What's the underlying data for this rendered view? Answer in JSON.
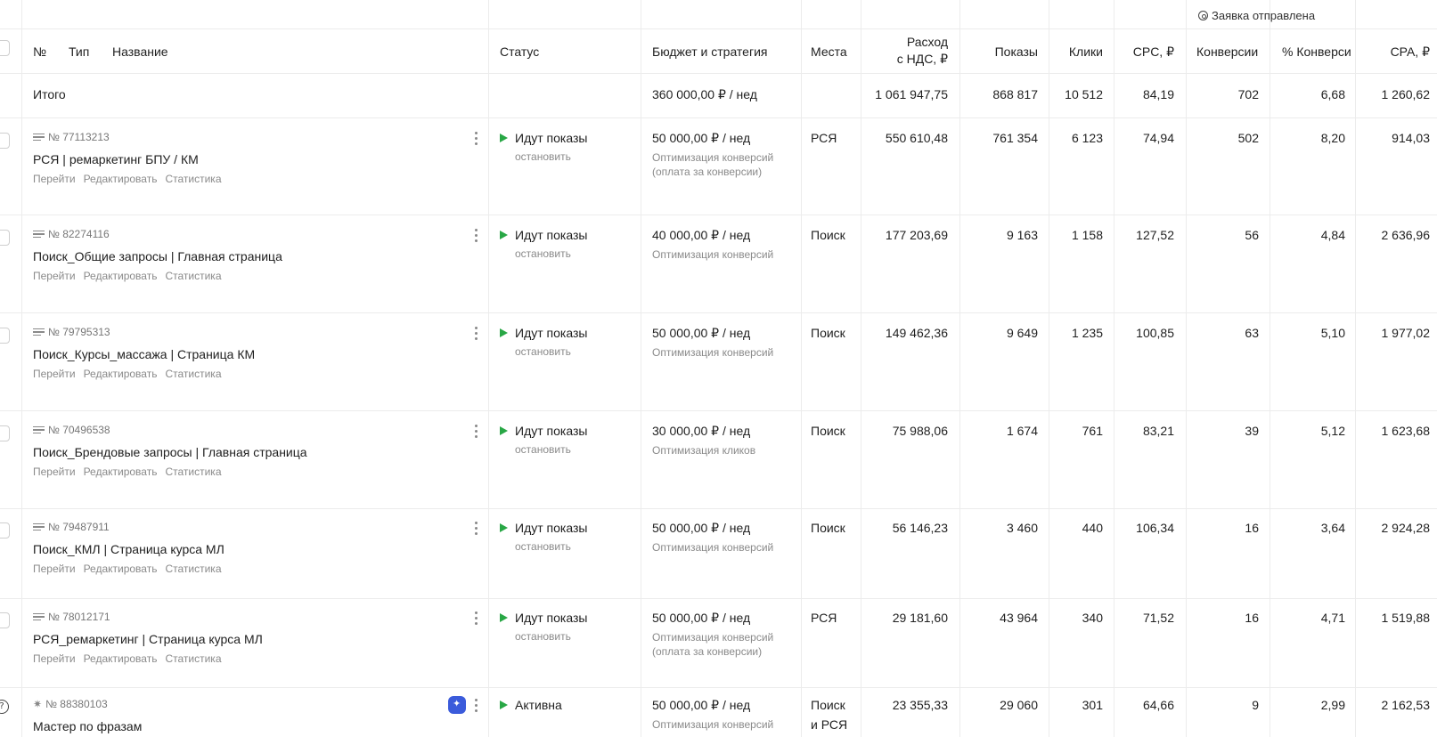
{
  "top_status": "Заявка отправлена",
  "headers": {
    "num": "№",
    "type": "Тип",
    "name": "Название",
    "status": "Статус",
    "budget": "Бюджет и стратегия",
    "places": "Места",
    "spend_line1": "Расход",
    "spend_line2": "с НДС, ₽",
    "impressions": "Показы",
    "clicks": "Клики",
    "cpc": "CPC, ₽",
    "conversions": "Конверсии",
    "conv_rate": "% Конверси",
    "cpa": "CPA, ₽"
  },
  "total": {
    "label": "Итого",
    "budget": "360 000,00 ₽ / нед",
    "spend": "1 061 947,75",
    "impressions": "868 817",
    "clicks": "10 512",
    "cpc": "84,19",
    "conversions": "702",
    "conv_rate": "6,68",
    "cpa": "1 260,62"
  },
  "link_labels": {
    "go": "Перейти",
    "edit": "Редактировать",
    "stats": "Статистика"
  },
  "rows": [
    {
      "id": "№ 77113213",
      "name": "РСЯ | ремаркетинг БПУ / КМ",
      "status": "Идут показы",
      "stop": "остановить",
      "budget": "50 000,00 ₽ / нед",
      "strategy1": "Оптимизация конверсий",
      "strategy2": "(оплата за конверсии)",
      "place1": "РСЯ",
      "place2": "",
      "spend": "550 610,48",
      "impressions": "761 354",
      "clicks": "6 123",
      "cpc": "74,94",
      "conversions": "502",
      "conv_rate": "8,20",
      "cpa": "914,03"
    },
    {
      "id": "№ 82274116",
      "name": "Поиск_Общие запросы | Главная страница",
      "status": "Идут показы",
      "stop": "остановить",
      "budget": "40 000,00 ₽ / нед",
      "strategy1": "Оптимизация конверсий",
      "strategy2": "",
      "place1": "Поиск",
      "place2": "",
      "spend": "177 203,69",
      "impressions": "9 163",
      "clicks": "1 158",
      "cpc": "127,52",
      "conversions": "56",
      "conv_rate": "4,84",
      "cpa": "2 636,96"
    },
    {
      "id": "№ 79795313",
      "name": "Поиск_Курсы_массажа | Страница КМ",
      "status": "Идут показы",
      "stop": "остановить",
      "budget": "50 000,00 ₽ / нед",
      "strategy1": "Оптимизация конверсий",
      "strategy2": "",
      "place1": "Поиск",
      "place2": "",
      "spend": "149 462,36",
      "impressions": "9 649",
      "clicks": "1 235",
      "cpc": "100,85",
      "conversions": "63",
      "conv_rate": "5,10",
      "cpa": "1 977,02"
    },
    {
      "id": "№ 70496538",
      "name": "Поиск_Брендовые запросы | Главная страница",
      "status": "Идут показы",
      "stop": "остановить",
      "budget": "30 000,00 ₽ / нед",
      "strategy1": "Оптимизация кликов",
      "strategy2": "",
      "place1": "Поиск",
      "place2": "",
      "spend": "75 988,06",
      "impressions": "1 674",
      "clicks": "761",
      "cpc": "83,21",
      "conversions": "39",
      "conv_rate": "5,12",
      "cpa": "1 623,68"
    },
    {
      "id": "№ 79487911",
      "name": "Поиск_КМЛ | Страница курса МЛ",
      "status": "Идут показы",
      "stop": "остановить",
      "budget": "50 000,00 ₽ / нед",
      "strategy1": "Оптимизация конверсий",
      "strategy2": "",
      "place1": "Поиск",
      "place2": "",
      "spend": "56 146,23",
      "impressions": "3 460",
      "clicks": "440",
      "cpc": "106,34",
      "conversions": "16",
      "conv_rate": "3,64",
      "cpa": "2 924,28"
    },
    {
      "id": "№ 78012171",
      "name": "РСЯ_ремаркетинг | Страница курса МЛ",
      "status": "Идут показы",
      "stop": "остановить",
      "budget": "50 000,00 ₽ / нед",
      "strategy1": "Оптимизация конверсий",
      "strategy2": "(оплата за конверсии)",
      "place1": "РСЯ",
      "place2": "",
      "spend": "29 181,60",
      "impressions": "43 964",
      "clicks": "340",
      "cpc": "71,52",
      "conversions": "16",
      "conv_rate": "4,71",
      "cpa": "1 519,88"
    },
    {
      "id": "№ 88380103",
      "name": "Мастер по фразам",
      "status": "Активна",
      "stop": "",
      "budget": "50 000,00 ₽ / нед",
      "strategy1": "Оптимизация конверсий",
      "strategy2": "",
      "place1": "Поиск",
      "place2": "и РСЯ",
      "spend": "23 355,33",
      "impressions": "29 060",
      "clicks": "301",
      "cpc": "64,66",
      "conversions": "9",
      "conv_rate": "2,99",
      "cpa": "2 162,53"
    }
  ],
  "colors": {
    "play": "#28a745",
    "muted": "#8a8a8a",
    "badge": "#3b5bdb"
  }
}
